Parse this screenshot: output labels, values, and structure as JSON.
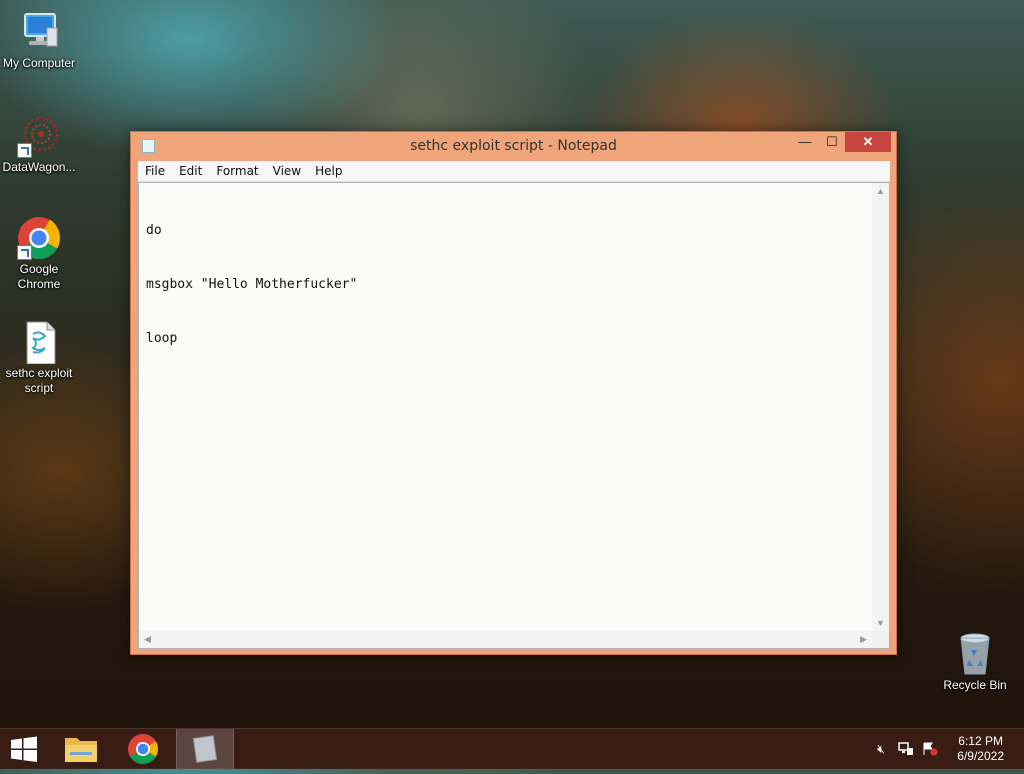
{
  "desktop": {
    "icons": [
      {
        "label": "My Computer",
        "icon": "computer-icon"
      },
      {
        "label": "DataWagon...",
        "icon": "datawagon-icon"
      },
      {
        "label": "Google Chrome",
        "icon": "chrome-icon"
      },
      {
        "label": "sethc exploit script",
        "icon": "script-file-icon"
      },
      {
        "label": "Recycle Bin",
        "icon": "recycle-bin-icon"
      }
    ]
  },
  "window": {
    "title": "sethc exploit script - Notepad",
    "buttons": {
      "minimize": "—",
      "maximize": "☐",
      "close": "✕"
    },
    "menu": [
      "File",
      "Edit",
      "Format",
      "View",
      "Help"
    ],
    "content": [
      "do",
      "msgbox \"Hello Motherfucker\"",
      "loop"
    ]
  },
  "taskbar": {
    "items": [
      "start-button",
      "file-explorer",
      "google-chrome",
      "notepad"
    ],
    "clock": {
      "time": "6:12 PM",
      "date": "6/9/2022"
    },
    "tray": [
      "volume-muted-icon",
      "network-icon",
      "action-center-icon"
    ]
  },
  "colors": {
    "window_frame": "#f0a47a",
    "close_button": "#c7443f",
    "taskbar": "#3c1e16"
  }
}
